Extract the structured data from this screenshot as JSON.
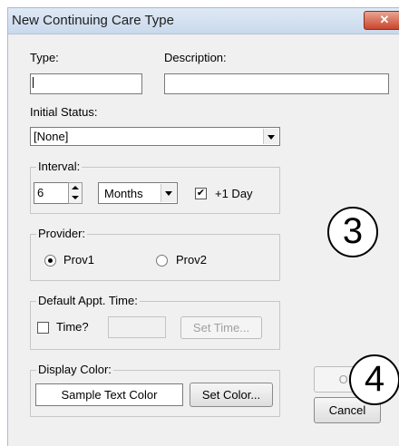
{
  "window": {
    "title": "New Continuing Care Type",
    "close_glyph": "✕"
  },
  "fields": {
    "type_label": "Type:",
    "type_value": "",
    "description_label": "Description:",
    "description_value": "",
    "initial_status_label": "Initial Status:",
    "initial_status_value": "[None]"
  },
  "interval": {
    "label": "Interval:",
    "count": "6",
    "unit": "Months",
    "plus_one_day_label": "+1 Day",
    "plus_one_day_checked": "✔"
  },
  "provider": {
    "label": "Provider:",
    "options": [
      "Prov1",
      "Prov2"
    ],
    "selected": "Prov1"
  },
  "appointment": {
    "label": "Default Appt. Time:",
    "time_checkbox_label": "Time?",
    "time_value": "",
    "set_time_label": "Set Time..."
  },
  "display_color": {
    "label": "Display Color:",
    "sample_text": "Sample Text Color",
    "set_color_label": "Set Color..."
  },
  "buttons": {
    "ok": "OK",
    "cancel": "Cancel"
  },
  "callouts": {
    "step3": "3",
    "step4": "4"
  }
}
